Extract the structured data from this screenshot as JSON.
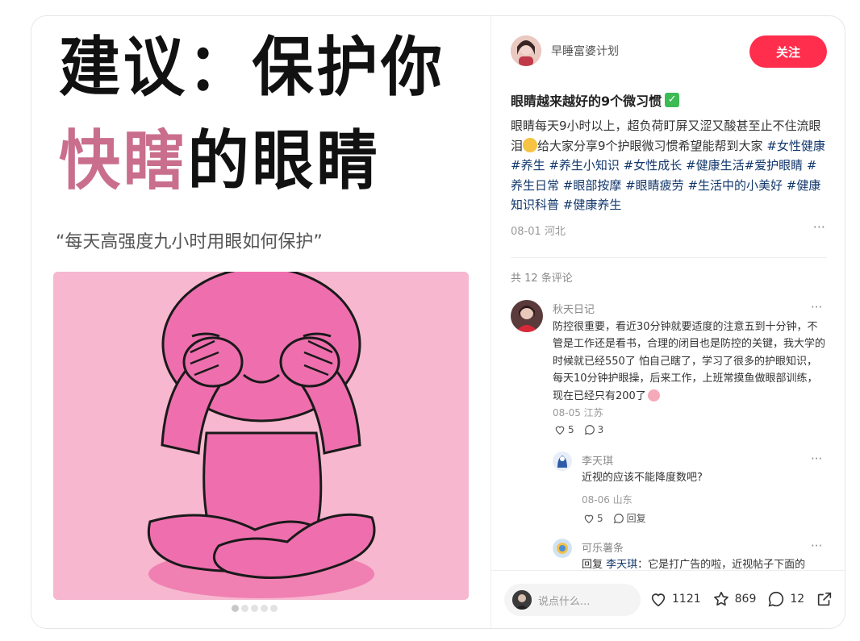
{
  "cover": {
    "headline_line1": "建议：保护你",
    "headline_line2_highlight": "快瞎",
    "headline_line2_rest": "的眼睛",
    "quote": "“每天高强度九小时用眼如何保护”",
    "carousel_total": 5,
    "carousel_active": 1
  },
  "author": {
    "name": "早睡富婆计划"
  },
  "follow_label": "关注",
  "post": {
    "title": "眼睛越来越好的9个微习惯",
    "body_part1": "眼睛每天9小时以上，超负荷盯屏又涩又酸甚至止不住流眼泪",
    "body_part2": "给大家分享9个护眼微习惯希望能帮到大家",
    "tags": "#女性健康 #养生 #养生小知识 #女性成长 #健康生活#爱护眼睛 #养生日常 #眼部按摩 #眼睛疲劳 #生活中的小美好 #健康知识科普 #健康养生",
    "meta": "08-01 河北",
    "more": "···"
  },
  "comments_header": "共 12 条评论",
  "comments": [
    {
      "name": "秋天日记",
      "text": "防控很重要，看近30分钟就要适度的注意五到十分钟，不管是工作还是看书，合理的闭目也是防控的关键，我大学的时候就已经550了 怕自己瞎了，学习了很多的护眼知识，每天10分钟护眼操，后来工作，上班常摸鱼做眼部训练，现在已经只有200了",
      "meta": "08-05 江苏",
      "likes": "5",
      "replies": "3",
      "more": "···"
    },
    {
      "name": "李天琪",
      "text": "近视的应该不能降度数吧?",
      "meta": "08-06 山东",
      "likes": "5",
      "reply_label": "回复",
      "more": "···"
    },
    {
      "name": "可乐薯条",
      "reply_prefix": "回复 ",
      "reply_to": "李天琪",
      "text": "：它是打广告的啦，近视帖子下面的",
      "more": "···"
    }
  ],
  "bottom": {
    "input_placeholder": "说点什么...",
    "likes": "1121",
    "stars": "869",
    "comments": "12"
  },
  "colors": {
    "accent": "#ff2e4d",
    "tag": "#13386c",
    "highlight": "#c96e8c"
  }
}
